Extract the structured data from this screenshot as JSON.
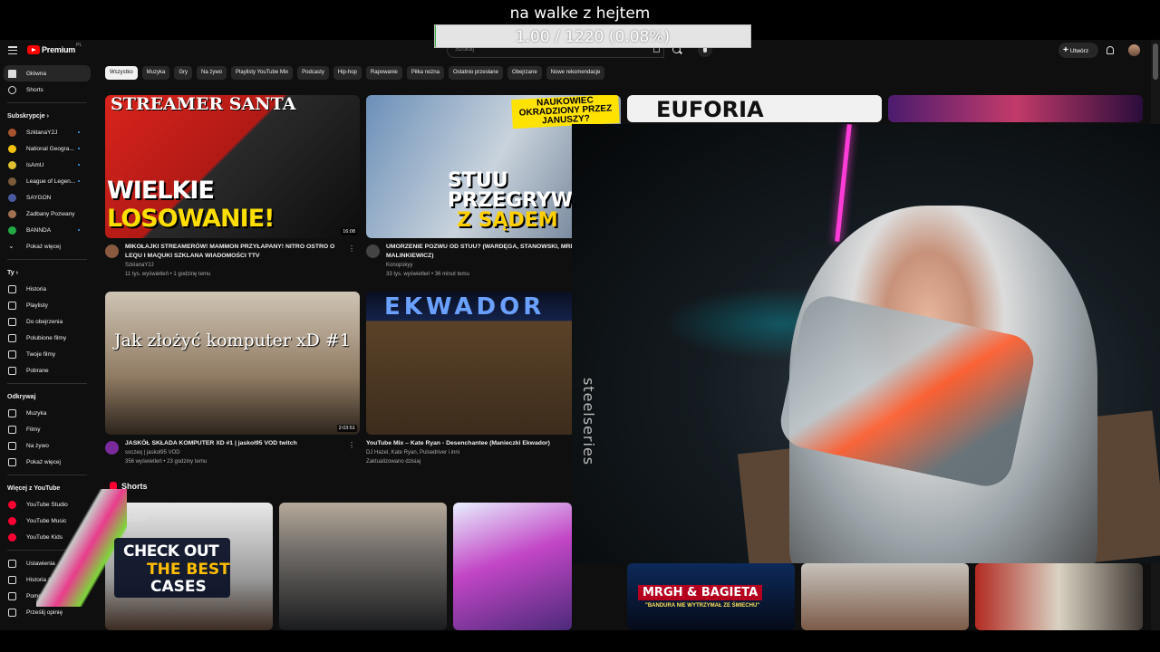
{
  "overlay": {
    "title": "na walke z hejtem",
    "goal_text": "1.00 / 1220 (0.08%)",
    "goal_progress": 0.0008
  },
  "header": {
    "logo_text": "Premium",
    "logo_badge": "PL",
    "search_placeholder": "Szukaj",
    "create_label": "Utwórz"
  },
  "sidebar": {
    "main": [
      {
        "label": "Główna",
        "icon": "home-icon"
      },
      {
        "label": "Shorts",
        "icon": "shorts-icon"
      }
    ],
    "subs_head": "Subskrypcje",
    "subs": [
      {
        "label": "SzklanaY2J",
        "color": "#a8552e"
      },
      {
        "label": "National Geogra...",
        "color": "#f4c20d"
      },
      {
        "label": "IsAmU",
        "color": "#e0c030"
      },
      {
        "label": "League of Legen...",
        "color": "#7a5a3a"
      },
      {
        "label": "SAYGON",
        "color": "#4a5aa0"
      },
      {
        "label": "Zadbany Pozwany",
        "color": "#a07050"
      },
      {
        "label": "BANNDA",
        "color": "#22aa44"
      }
    ],
    "subs_more": "Pokaż więcej",
    "you_head": "Ty",
    "you": [
      {
        "label": "Historia",
        "icon": "history-icon"
      },
      {
        "label": "Playlisty",
        "icon": "playlist-icon"
      },
      {
        "label": "Do obejrzenia",
        "icon": "watch-later-icon"
      },
      {
        "label": "Polubione filmy",
        "icon": "like-icon"
      },
      {
        "label": "Twoje filmy",
        "icon": "your-videos-icon"
      },
      {
        "label": "Pobrane",
        "icon": "download-icon"
      }
    ],
    "explore_head": "Odkrywaj",
    "explore": [
      {
        "label": "Muzyka",
        "icon": "music-icon"
      },
      {
        "label": "Filmy",
        "icon": "film-icon"
      },
      {
        "label": "Na żywo",
        "icon": "live-icon"
      },
      {
        "label": "Pokaż więcej",
        "icon": "chevron-down-icon"
      }
    ],
    "more_head": "Więcej z YouTube",
    "more": [
      {
        "label": "YouTube Studio"
      },
      {
        "label": "YouTube Music"
      },
      {
        "label": "YouTube Kids"
      }
    ],
    "bottom": [
      {
        "label": "Ustawienia",
        "icon": "settings-icon"
      },
      {
        "label": "Historia zgłoszeń",
        "icon": "flag-icon"
      },
      {
        "label": "Pomoc",
        "icon": "help-icon"
      },
      {
        "label": "Prześlij opinię",
        "icon": "feedback-icon"
      }
    ]
  },
  "chips": [
    "Wszystko",
    "Muzyka",
    "Gry",
    "Na żywo",
    "Playlisty YouTube Mix",
    "Podcasty",
    "Hip-hop",
    "Rapowanie",
    "Piłka nożna",
    "Ostatnio przesłane",
    "Obejrzane",
    "Nowe rekomendacje"
  ],
  "videos": [
    {
      "thumb_title": "STREAMER SANTA",
      "thumb_banner_a": "WIELKIE ",
      "thumb_banner_b": "LOSOWANIE!",
      "duration": "16:08",
      "title": "MIKOŁAJKI STREAMERÓW! MAMMON PRZYŁAPANY! NITRO OSTRO O LEQU I MAQUKI SZKLANA WIADOMOŚCI TTV",
      "channel": "SzklanaY2J",
      "stats": "11 tys. wyświetleń • 1 godzinę temu"
    },
    {
      "thumb_top": "NAUKOWIEC OKRADZIONY PRZEZ JANUSZY?",
      "thumb_banner_a": "STUU PRZEGRYWA",
      "thumb_banner_b": "Z SĄDEM",
      "title": "UMORZENIE POZWU OD STUU? (WARDĘGA, STANOWSKI, MRBEAST, MALINKIEWICZ)",
      "channel": "Konopskyy",
      "stats": "33 tys. wyświetleń • 36 minut temu"
    },
    {
      "thumb_text": "Jak złożyć komputer xD #1",
      "duration": "2:03:51",
      "title": "JASKÓŁ SKŁADA KOMPUTER XD #1 | jaskol95 VOD twitch",
      "channel": "soczeq | jaskol95 VOD",
      "stats": "356 wyświetleń • 23 godziny temu"
    },
    {
      "thumb_text": "EKWADOR",
      "title": "YouTube Mix – Kate Ryan - Desenchantee (Manieczki Ekwador)",
      "channel": "DJ Hazel, Kate Ryan, Pulsedriver i inni",
      "stats": "Zaktualizowano dzisiaj"
    },
    {
      "thumb_text": "EUFORIA"
    }
  ],
  "shorts": {
    "heading": "Shorts",
    "s4_banner": "MRGH & BAGIETA",
    "s4_sub": "\"BANDURA NIE WYTRZYMAŁ ZE ŚMIECHU\"",
    "s1_text": "ZERO"
  },
  "webcam": {
    "brand": "steelseries"
  },
  "cases": {
    "line1": "CHECK OUT",
    "line2": "THE BEST",
    "line3": "CASES"
  }
}
